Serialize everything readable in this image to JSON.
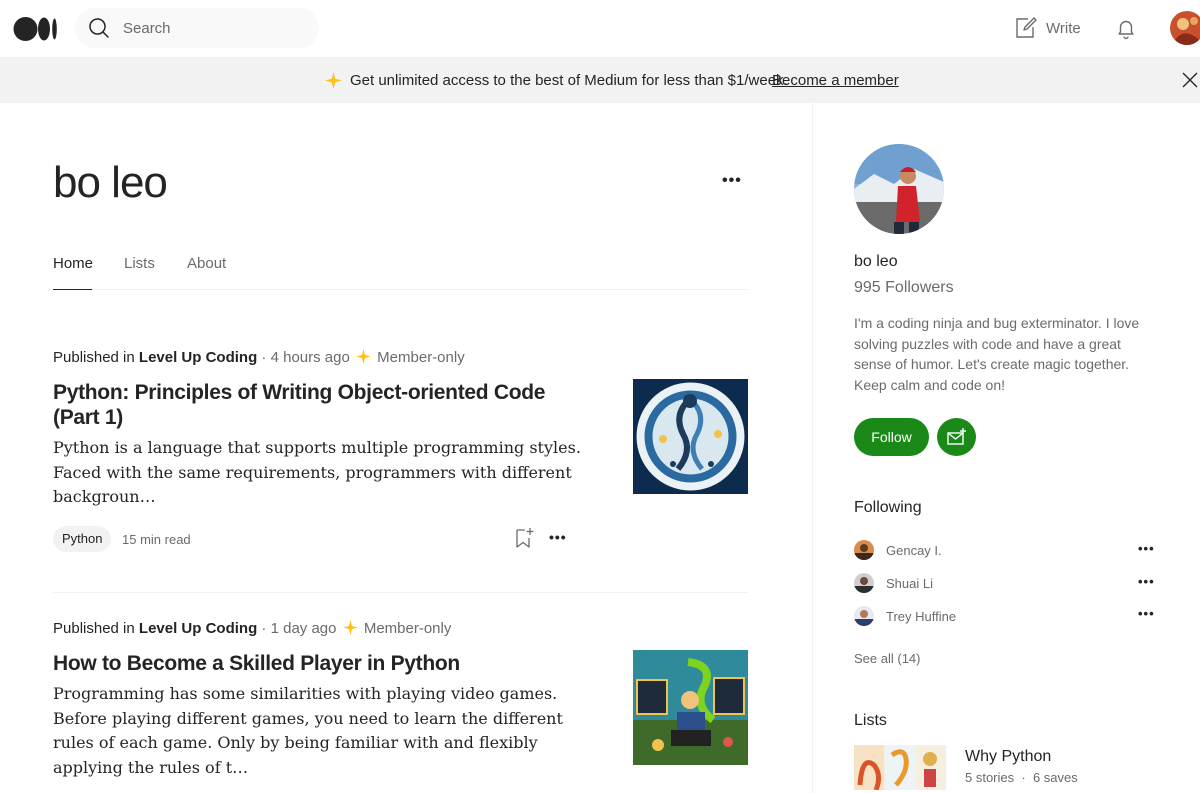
{
  "header": {
    "search_placeholder": "Search",
    "write_label": "Write"
  },
  "banner": {
    "text": "Get unlimited access to the best of Medium for less than $1/week.",
    "link": "Become a member"
  },
  "profile": {
    "name": "bo leo",
    "tabs": [
      {
        "label": "Home",
        "active": true
      },
      {
        "label": "Lists",
        "active": false
      },
      {
        "label": "About",
        "active": false
      }
    ]
  },
  "articles": [
    {
      "published_in_label": "Published in",
      "publication": "Level Up Coding",
      "time": "4 hours ago",
      "member_label": "Member-only",
      "title": "Python: Principles of Writing Object-oriented Code (Part 1)",
      "excerpt": "Python is a language that supports multiple programming styles. Faced with the same requirements, programmers with different backgroun…",
      "tag": "Python",
      "read_time": "15 min read"
    },
    {
      "published_in_label": "Published in",
      "publication": "Level Up Coding",
      "time": "1 day ago",
      "member_label": "Member-only",
      "title": "How to Become a Skilled Player in Python",
      "excerpt": "Programming has some similarities with playing video games. Before playing different games, you need to learn the different rules of each game. Only by being familiar with and flexibly applying the rules of t…"
    }
  ],
  "sidebar": {
    "name": "bo leo",
    "followers": "995 Followers",
    "bio": "I'm a coding ninja and bug exterminator. I love solving puzzles with code and have a great sense of humor. Let's create magic together. Keep calm and code on!",
    "follow_label": "Follow",
    "following_heading": "Following",
    "following": [
      {
        "name": "Gencay I."
      },
      {
        "name": "Shuai Li"
      },
      {
        "name": "Trey Huffine"
      }
    ],
    "see_all": "See all (14)",
    "lists_heading": "Lists",
    "list": {
      "title": "Why Python",
      "stories": "5 stories",
      "saves": "6 saves"
    }
  },
  "colors": {
    "accent_green": "#1a8917",
    "member_star": "#ffc017",
    "text_primary": "#242424",
    "text_secondary": "#6b6b6b"
  }
}
